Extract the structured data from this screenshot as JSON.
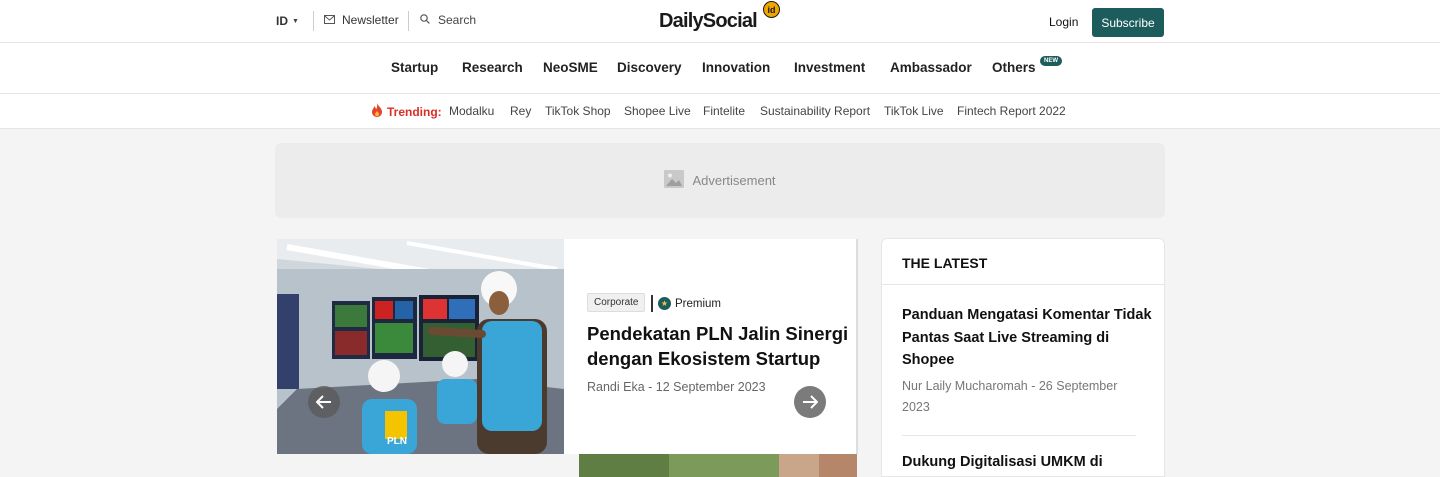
{
  "header": {
    "language": "ID",
    "newsletter_label": "Newsletter",
    "search_label": "Search",
    "logo_text": "DailySocial",
    "logo_badge": "id",
    "login_label": "Login",
    "subscribe_label": "Subscribe"
  },
  "nav": {
    "items": [
      "Startup",
      "Research",
      "NeoSME",
      "Discovery",
      "Innovation",
      "Investment",
      "Ambassador",
      "Others"
    ],
    "new_badge": "NEW"
  },
  "trending": {
    "label": "Trending:",
    "items": [
      "Modalku",
      "Rey",
      "TikTok Shop",
      "Shopee Live",
      "Fintelite",
      "Sustainability Report",
      "TikTok Live",
      "Fintech Report 2022"
    ]
  },
  "ad": {
    "label": "Advertisement"
  },
  "featured": {
    "category": "Corporate",
    "premium_label": "Premium",
    "title": "Pendekatan PLN Jalin Sinergi dengan Ekosistem Startup",
    "meta": "Randi Eka - 12 September 2023",
    "image_logo_text": "PLN"
  },
  "latest": {
    "heading": "THE LATEST",
    "items": [
      {
        "title": "Panduan Mengatasi Komentar Tidak Pantas Saat Live Streaming di Shopee",
        "meta": "Nur Laily Mucharomah - 26 September 2023"
      },
      {
        "title": "Dukung Digitalisasi UMKM di",
        "meta": ""
      }
    ]
  },
  "colors": {
    "brand_teal": "#1d5c5c",
    "trending_red": "#d93025",
    "logo_badge": "#f0a500"
  },
  "icons": {
    "language_caret": "caret-down-icon",
    "newsletter": "mail-icon",
    "search": "search-icon",
    "trending": "fire-icon",
    "ad": "image-icon",
    "premium": "star-badge-icon",
    "prev": "arrow-left-icon",
    "next": "arrow-right-icon"
  }
}
